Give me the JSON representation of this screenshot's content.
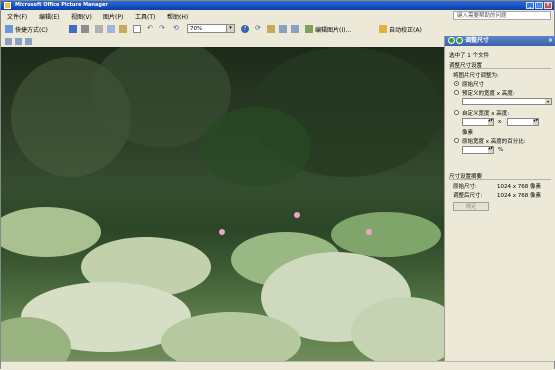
{
  "window": {
    "title": "Microsoft Office Picture Manager"
  },
  "menu": {
    "items": [
      "文件(F)",
      "编辑(E)",
      "视图(V)",
      "图片(P)",
      "工具(T)",
      "帮助(H)"
    ]
  },
  "help_search": {
    "placeholder": "键入需要帮助的问题"
  },
  "toolbar": {
    "shortcuts_label": "快捷方式(C)",
    "zoom_value": "70%",
    "edit_picture_label": "编辑图片(I)...",
    "auto_correct_label": "自动校正(A)"
  },
  "task_pane": {
    "title": "调整尺寸",
    "selected_info": "选中了 1 个文件",
    "settings_heading": "调整尺寸设置",
    "resize_to_label": "将图片尺寸调整为:",
    "option_original": "原始尺寸",
    "option_predefined": "预定义的宽度 x 高度:",
    "option_custom": "自定义宽度 x 高度:",
    "x_sep": "x",
    "unit_pixels": "像素",
    "option_percent": "原始宽度 x 高度的百分比:",
    "percent_sign": "%",
    "summary_heading": "尺寸设置摘要",
    "original_size_label": "原始尺寸:",
    "original_size_value": "1024 x 768 像素",
    "resized_label": "调整后尺寸:",
    "resized_value": "1024 x 768 像素",
    "ok_button": "确定"
  },
  "colors": {
    "title_bar": "#0a3fa8",
    "task_pane_header": "#3a62a8",
    "chrome": "#ece9d8"
  },
  "icons": [
    "app-icon",
    "shortcuts-icon",
    "save-icon",
    "print-icon",
    "cut-icon",
    "copy-icon",
    "paste-icon",
    "delete-icon",
    "undo-icon",
    "redo-icon",
    "rotate-left-icon",
    "rotate-right-icon",
    "help-icon",
    "thumbnail-view-icon",
    "filmstrip-view-icon",
    "single-view-icon",
    "edit-picture-icon",
    "auto-correct-icon",
    "back-icon",
    "forward-icon",
    "close-icon"
  ]
}
